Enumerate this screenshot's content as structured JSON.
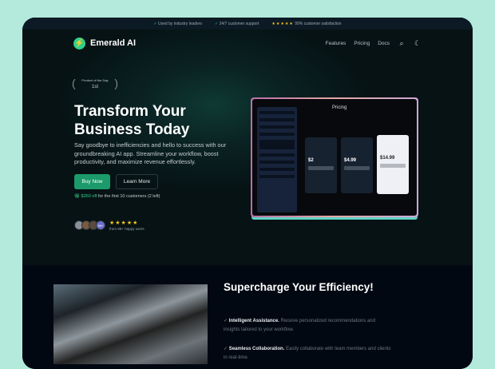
{
  "topbar": {
    "items": [
      "Used by industry leaders",
      "24/7 customer support"
    ],
    "stars": "★★★★★",
    "satisfaction": "99% customer satisfaction"
  },
  "nav": {
    "brand": "Emerald AI",
    "links": [
      "Features",
      "Pricing",
      "Docs"
    ]
  },
  "badge": {
    "label": "Product of the Day",
    "rank": "1st"
  },
  "hero": {
    "title": "Transform Your Business Today",
    "description": "Say goodbye to inefficiencies and hello to success with our groundbreaking AI app. Streamline your workflow, boost productivity, and maximize revenue effortlessly.",
    "buy": "Buy Now",
    "learn": "Learn More",
    "offer_amount": "$350 off",
    "offer_rest": "for the first 10 customers (2 left)",
    "avatar_more": "99+",
    "stars": "★★★★★",
    "users": "from 99+ happy users"
  },
  "mockup": {
    "title": "Pricing",
    "prices": [
      "$2",
      "$4.99",
      "$14.99"
    ]
  },
  "features": {
    "title": "Supercharge Your Efficiency!",
    "items": [
      {
        "title": "Intelligent Assistance.",
        "text": "Receive personalized recommendations and insights tailored to your workflow."
      },
      {
        "title": "Seamless Collaboration.",
        "text": "Easily collaborate with team members and clients in real-time."
      }
    ]
  },
  "colors": {
    "accent": "#1b9a6b",
    "background": "#040a12",
    "page": "#b4eadb"
  }
}
